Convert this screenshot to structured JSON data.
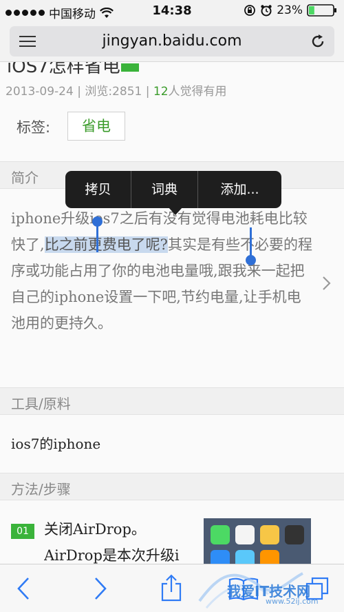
{
  "status_bar": {
    "carrier": "中国移动",
    "time": "14:38",
    "battery": "23%",
    "battery_level": 0.23
  },
  "browser": {
    "url": "jingyan.baidu.com"
  },
  "article": {
    "title_fragment": "iOS7怎样省电",
    "date": "2013-09-24",
    "views": "浏览:2851",
    "helpful_count": "12",
    "helpful_suffix": "人觉得有用",
    "tag_label": "标签:",
    "tag": "省电"
  },
  "sections": {
    "intro_header": "简介",
    "intro_before": "iphone升级ios7之后有没有觉得电池耗电比较快了,",
    "intro_selected": "比之前更费电了呢?",
    "intro_after": "其实是有些不必要的程序或功能占用了你的电池电量哦,跟我来一起把自己的iphone设置一下吧,节约电量,让手机电池用的更持久。",
    "tools_header": "工具/原料",
    "tools_text": "ios7的iphone",
    "steps_header": "方法/步骤",
    "step_num": "01",
    "step_title": "关闭AirDrop。",
    "step_desc": "AirDrop是本次升级i"
  },
  "popup_menu": {
    "copy": "拷贝",
    "dictionary": "词典",
    "add": "添加..."
  },
  "watermark": {
    "text": "我爱IT技术网",
    "url": "www.52ij.com"
  },
  "colors": {
    "green_accent": "#3ab33a",
    "selection_blue": "#2f6fd6",
    "selection_bg": "#c8d9ee"
  }
}
